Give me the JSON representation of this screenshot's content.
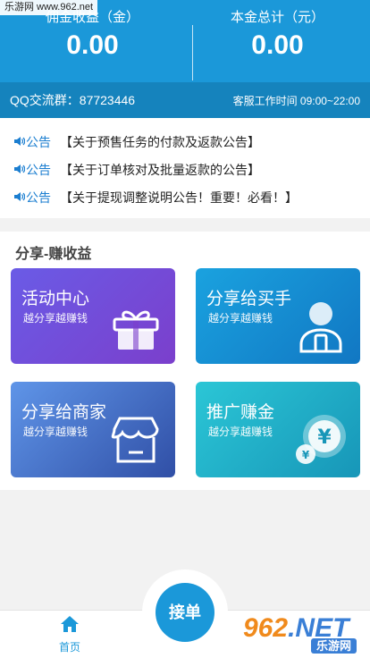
{
  "watermark_top": "乐游网 www.962.net",
  "stats": {
    "commission_label": "佣金收益（金）",
    "commission_value": "0.00",
    "principal_label": "本金总计（元）",
    "principal_value": "0.00"
  },
  "info_bar": {
    "qq_group": "QQ交流群：87723446",
    "service_hours": "客服工作时间 09:00~22:00"
  },
  "notices": [
    {
      "tag": "公告",
      "text": "【关于预售任务的付款及返款公告】"
    },
    {
      "tag": "公告",
      "text": "【关于订单核对及批量返款的公告】"
    },
    {
      "tag": "公告",
      "text": "【关于提现调整说明公告！重要！必看！】"
    }
  ],
  "share": {
    "title": "分享-赚收益",
    "cards": [
      {
        "title": "活动中心",
        "subtitle": "越分享越赚钱",
        "icon": "gift-icon",
        "color": "#6a4fdb"
      },
      {
        "title": "分享给买手",
        "subtitle": "越分享越赚钱",
        "icon": "buyer-icon",
        "color": "#1a8fd3"
      },
      {
        "title": "分享给商家",
        "subtitle": "越分享越赚钱",
        "icon": "shop-icon",
        "color": "#4a73cf"
      },
      {
        "title": "推广赚金",
        "subtitle": "越分享越赚钱",
        "icon": "yuan-coin-icon",
        "color": "#21b3c9"
      }
    ]
  },
  "tabbar": {
    "home_label": "首页",
    "accept_order_label": "接单"
  },
  "watermark_bottom": {
    "brand_num": "962",
    "brand_net": ".NET",
    "brand_cn": "乐游网"
  },
  "colors": {
    "primary": "#1b98d9",
    "primary_dark": "#1583bd",
    "notice_tag": "#1b7ed0"
  }
}
